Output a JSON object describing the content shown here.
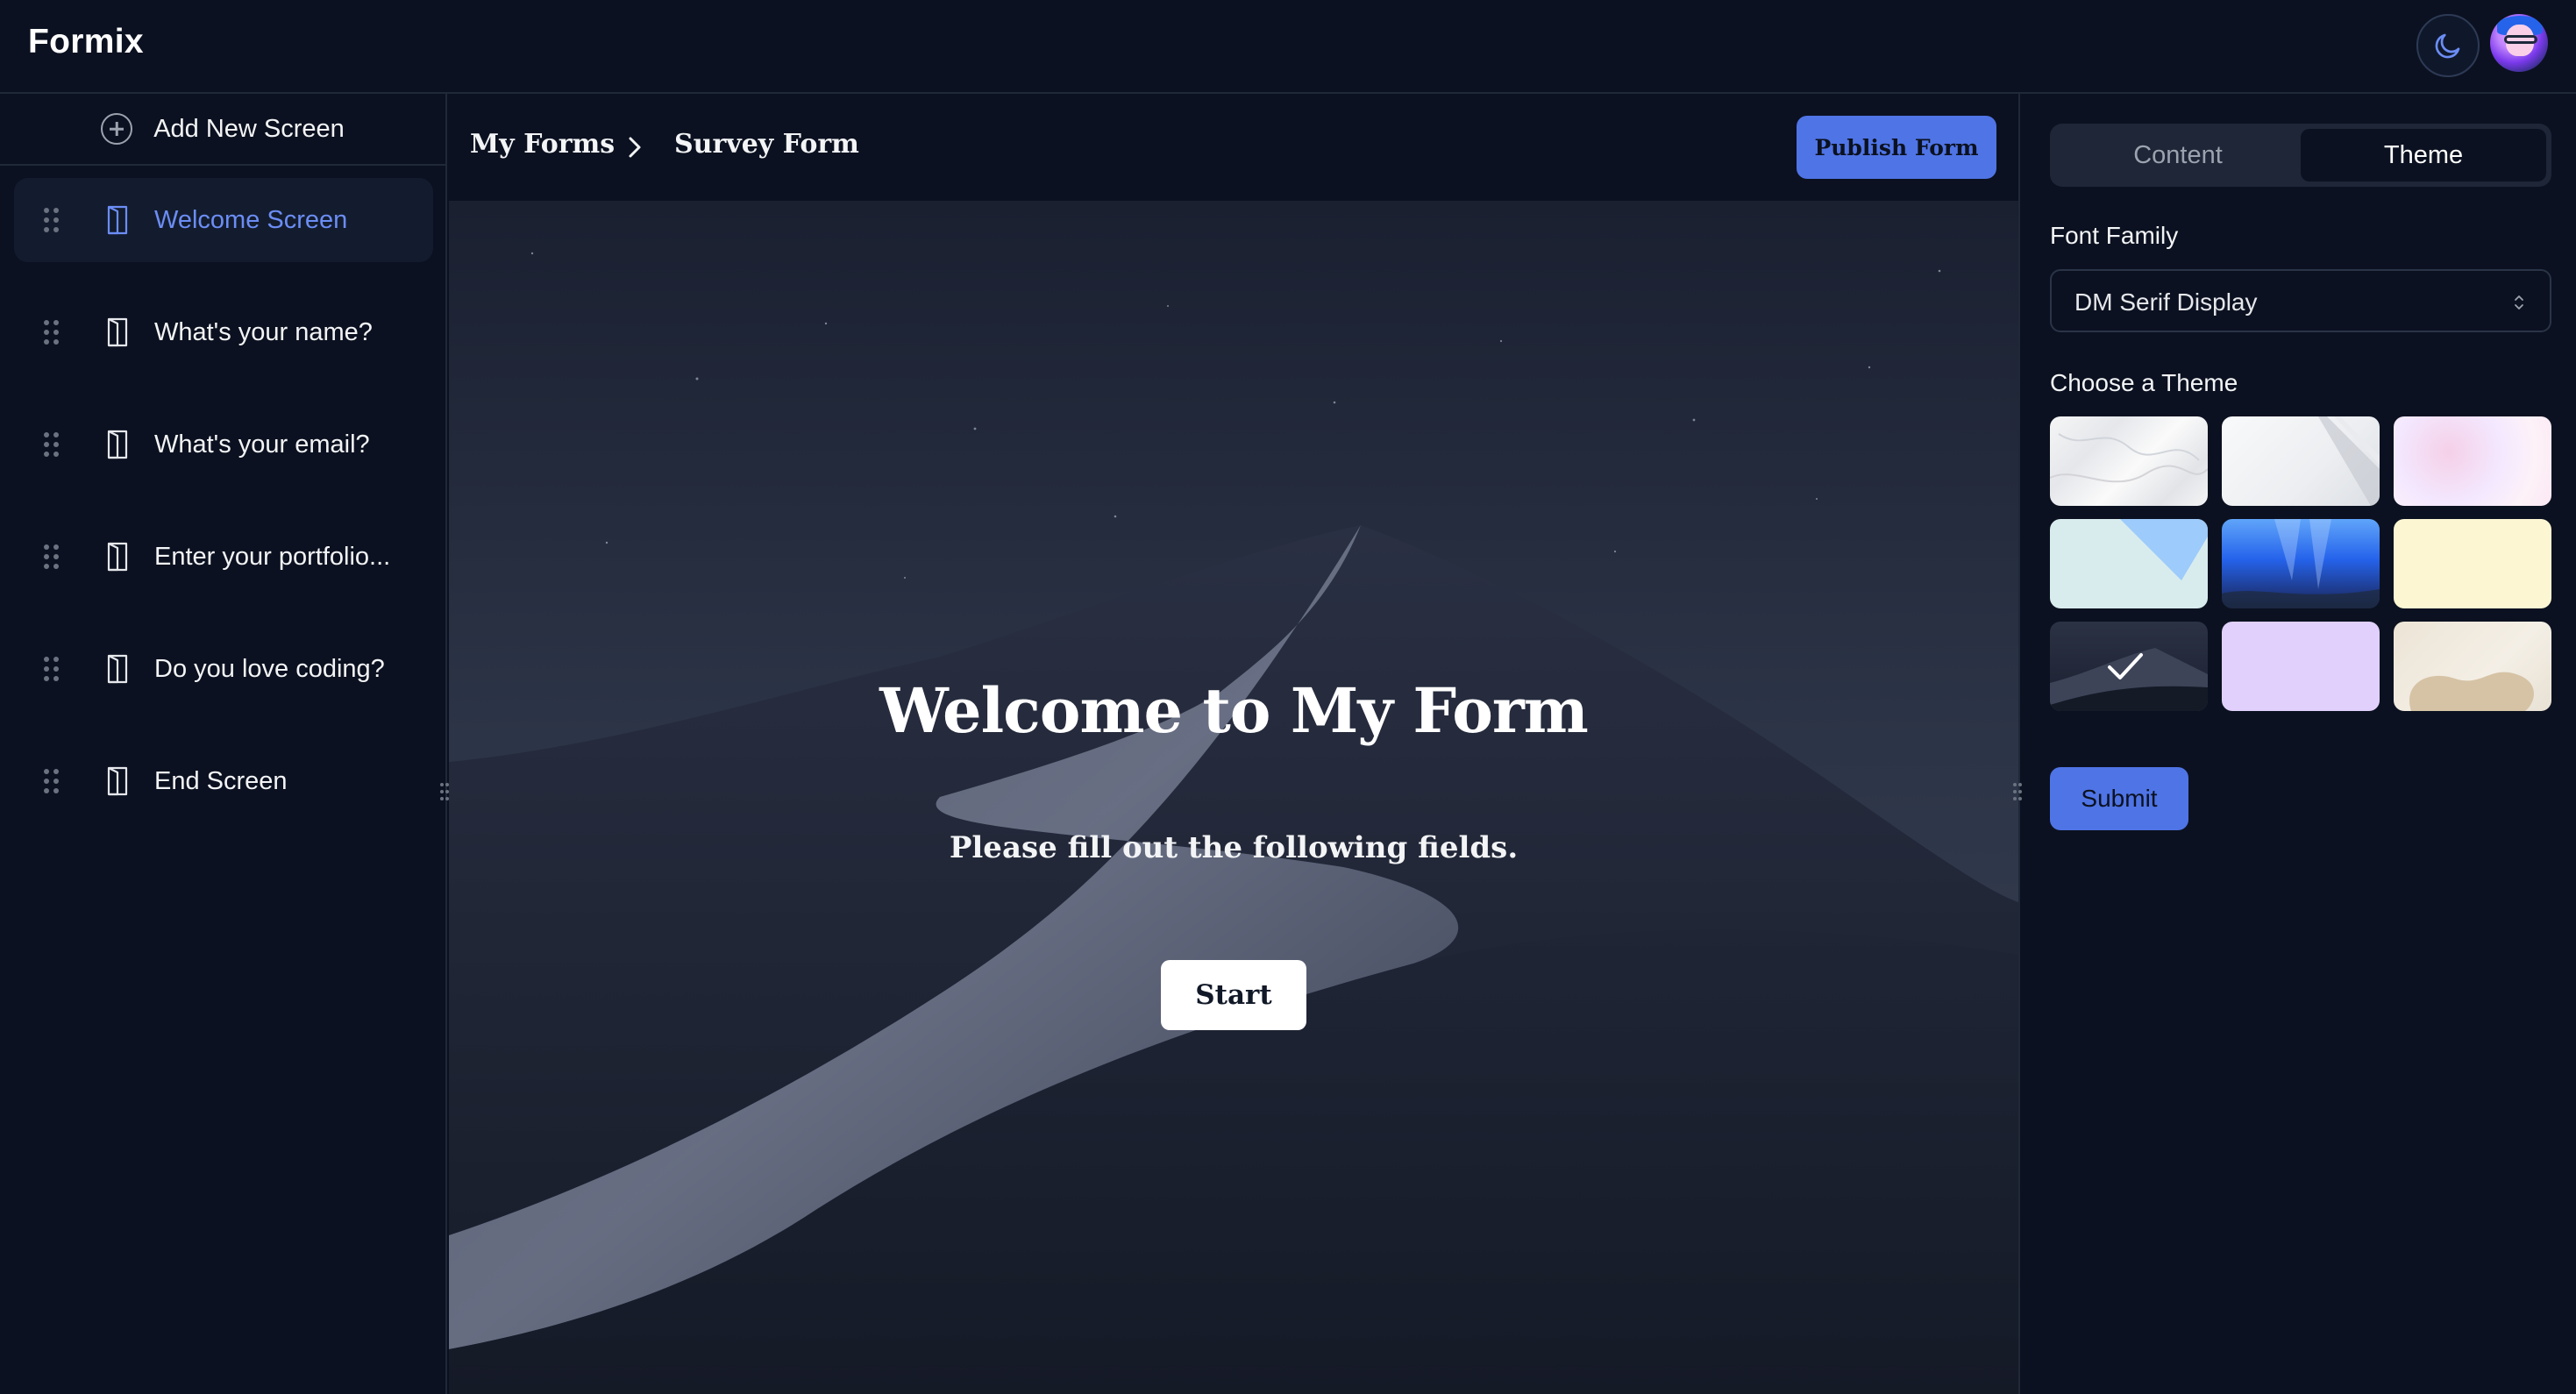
{
  "app": {
    "brand": "Formix"
  },
  "header": {
    "theme_toggle_icon": "moon-icon",
    "avatar_icon": "avatar"
  },
  "sidebar": {
    "add_label": "Add New Screen",
    "items": [
      {
        "label": "Welcome Screen",
        "active": true
      },
      {
        "label": "What's your name?",
        "active": false
      },
      {
        "label": "What's your email?",
        "active": false
      },
      {
        "label": "Enter your portfolio...",
        "active": false
      },
      {
        "label": "Do you love coding?",
        "active": false
      },
      {
        "label": "End Screen",
        "active": false
      }
    ]
  },
  "breadcrumb": {
    "root": "My Forms",
    "current": "Survey Form"
  },
  "toolbar": {
    "publish_label": "Publish Form"
  },
  "preview": {
    "title": "Welcome to My Form",
    "subtitle": "Please fill out the following fields.",
    "start_label": "Start"
  },
  "panel": {
    "tabs": [
      {
        "label": "Content"
      },
      {
        "label": "Theme"
      }
    ],
    "active_tab": "Theme",
    "font_family_label": "Font Family",
    "font_family_value": "DM Serif Display",
    "choose_theme_label": "Choose a Theme",
    "selected_theme_index": 6,
    "submit_label": "Submit"
  },
  "colors": {
    "accent": "#4f74e6",
    "active_item_text": "#6b8df5",
    "background": "#0b1120"
  }
}
